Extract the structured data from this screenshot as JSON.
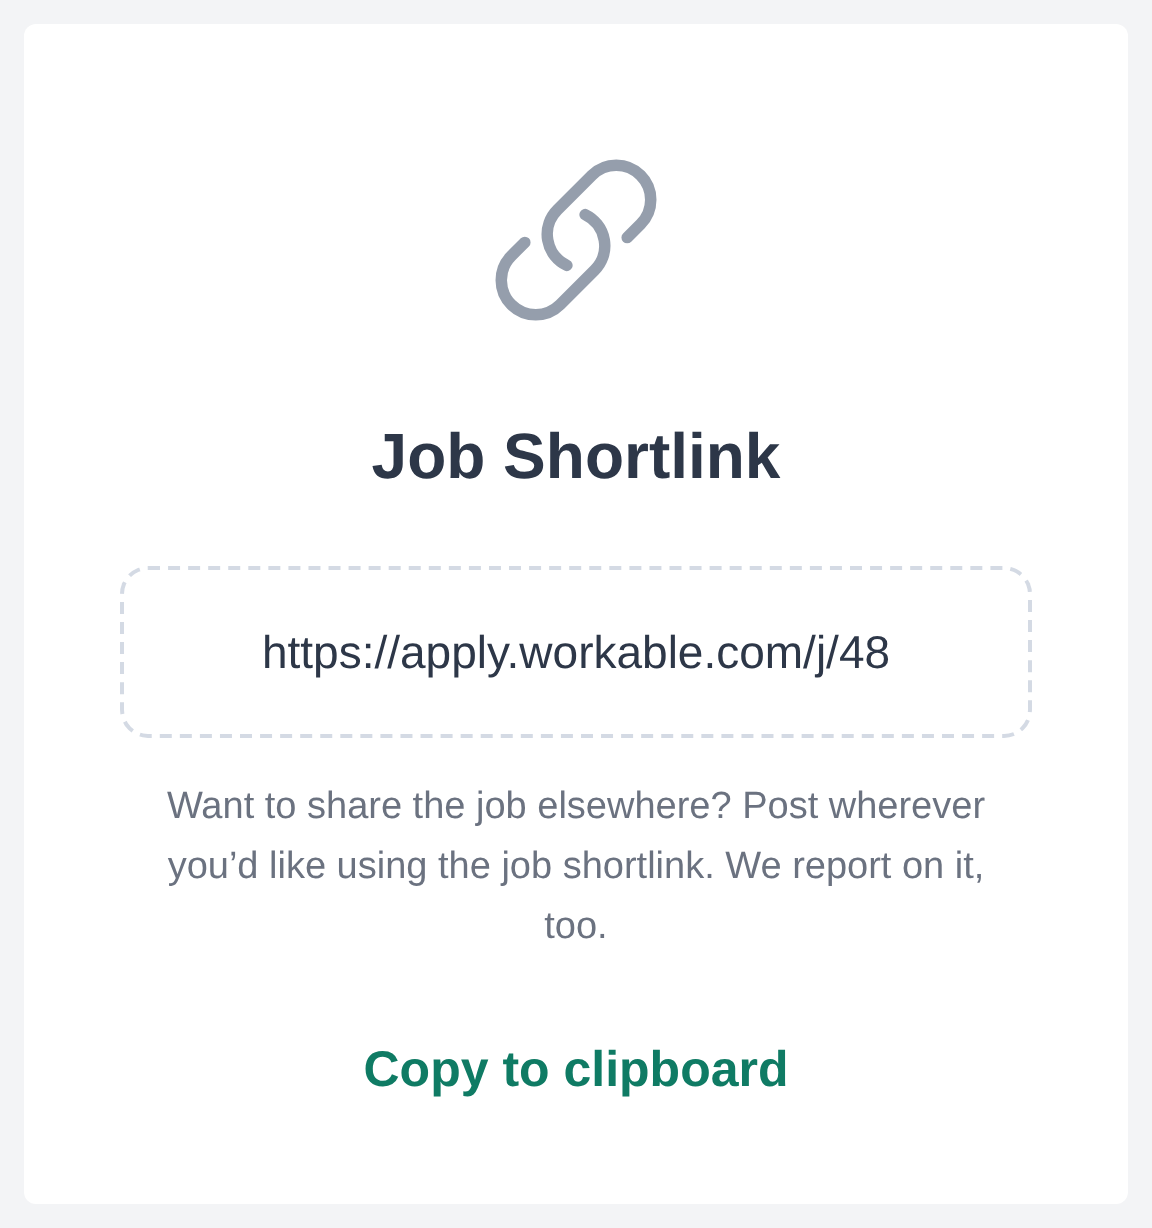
{
  "card": {
    "title": "Job Shortlink",
    "shortlink": {
      "value": "https://apply.workable.com/j/48"
    },
    "description": "Want to share the job elsewhere? Post wherever you’d like using the job shortlink. We report on it, too.",
    "action": "Copy to clipboard"
  }
}
